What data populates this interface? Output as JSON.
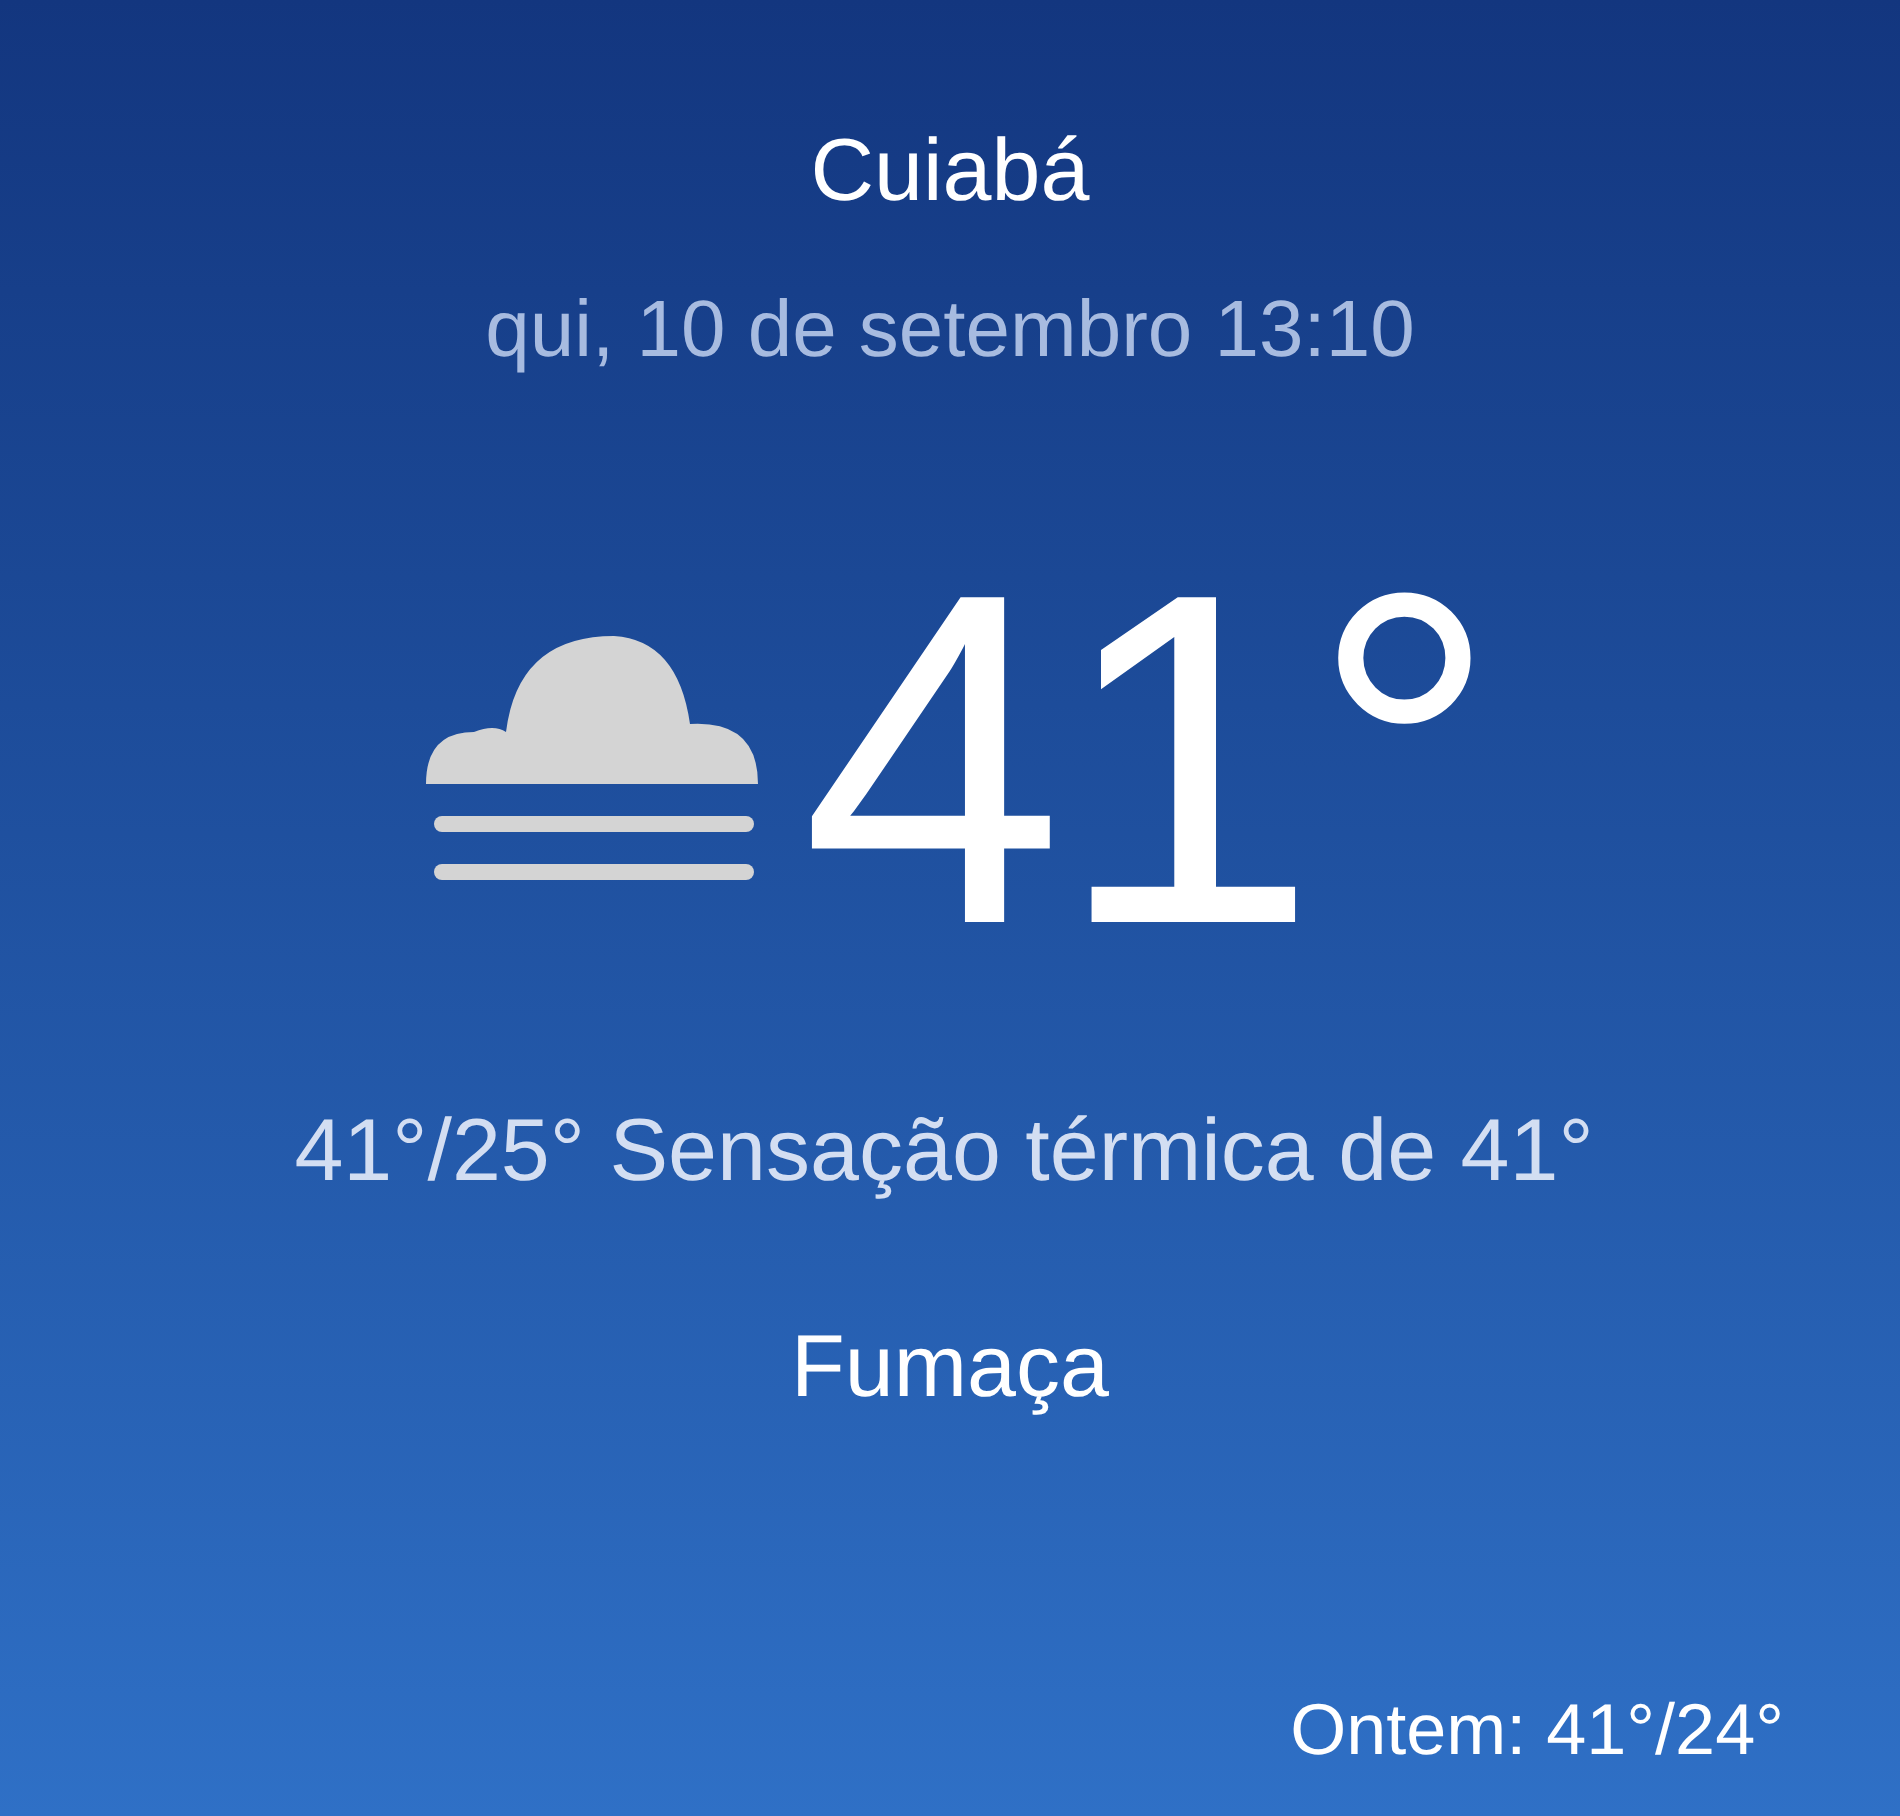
{
  "city": "Cuiabá",
  "datetime": "qui, 10 de setembro 13:10",
  "current": {
    "kind": "smoke",
    "temperature": "41°"
  },
  "range_feels_like": "41°/25° Sensação térmica de 41°",
  "condition": "Fumaça",
  "yesterday": "Ontem: 41°/24°"
}
